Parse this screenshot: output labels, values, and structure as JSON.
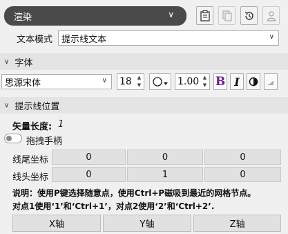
{
  "top": {
    "render_select": "渲染",
    "icons": [
      "clipboard-icon",
      "copy-icon",
      "history-icon",
      "user-icon"
    ]
  },
  "text_mode": {
    "label": "文本模式",
    "value": "提示线文本"
  },
  "font_section": {
    "title": "字体",
    "font_family": "思源宋体",
    "font_size": "18",
    "line_spacing": "1.00",
    "bold_label": "B",
    "italic_label": "I"
  },
  "hint_section": {
    "title": "提示线位置",
    "vector_length_label": "矢量长度:",
    "vector_length_value": "1",
    "drag_handle_label": "拖拽手柄",
    "drag_handle_on": false,
    "tail_label": "线尾坐标",
    "tail_values": [
      "0",
      "0",
      "0"
    ],
    "head_label": "线头坐标",
    "head_values": [
      "0",
      "1",
      "0"
    ],
    "note_line1": "说明：使用P键选择随意点，使用Ctrl+P磁吸到最近的网格节点。",
    "note_line2": "对点1使用‘1’和‘Ctrl+1’，对点2使用‘2’和‘Ctrl+2’.",
    "axis_buttons": [
      "X轴",
      "Y轴",
      "Z轴"
    ]
  }
}
